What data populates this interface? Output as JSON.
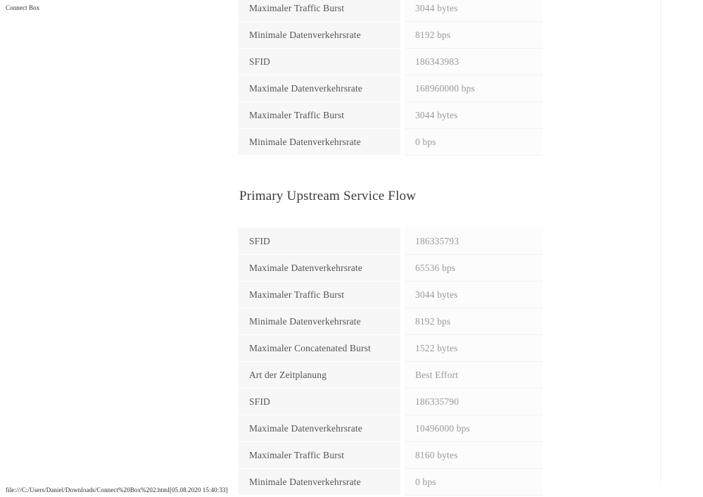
{
  "print": {
    "header_title": "Connect Box",
    "footer_text": "file:///C:/Users/Daniel/Downloads/Connect%20Box%202.html[05.08.2020 15:40:33]"
  },
  "colors": {
    "label_cell_bg": "#f7f7f7",
    "value_cell_bg": "#fcfcfc",
    "label_text": "#555555",
    "value_text": "#999999",
    "heading_text": "#3b3b3b",
    "row_divider": "#f2f2f2"
  },
  "sections": [
    {
      "id": "downstream-service-flow-continued",
      "heading": "",
      "rows": [
        {
          "label": "Maximaler Traffic Burst",
          "value": "3044 bytes"
        },
        {
          "label": "Minimale Datenverkehrsrate",
          "value": "8192 bps"
        },
        {
          "label": "SFID",
          "value": "186343983"
        },
        {
          "label": "Maximale Datenverkehrsrate",
          "value": "168960000 bps"
        },
        {
          "label": "Maximaler Traffic Burst",
          "value": "3044 bytes"
        },
        {
          "label": "Minimale Datenverkehrsrate",
          "value": "0 bps"
        }
      ]
    },
    {
      "id": "primary-upstream-service-flow",
      "heading": "Primary Upstream Service Flow",
      "rows": [
        {
          "label": "SFID",
          "value": "186335793"
        },
        {
          "label": "Maximale Datenverkehrsrate",
          "value": "65536 bps"
        },
        {
          "label": "Maximaler Traffic Burst",
          "value": "3044 bytes"
        },
        {
          "label": "Minimale Datenverkehrsrate",
          "value": "8192 bps"
        },
        {
          "label": "Maximaler Concatenated Burst",
          "value": "1522 bytes"
        },
        {
          "label": "Art der Zeitplanung",
          "value": "Best Effort"
        },
        {
          "label": "SFID",
          "value": "186335790"
        },
        {
          "label": "Maximale Datenverkehrsrate",
          "value": "10496000 bps"
        },
        {
          "label": "Maximaler Traffic Burst",
          "value": "8160 bytes"
        },
        {
          "label": "Minimale Datenverkehrsrate",
          "value": "0 bps"
        }
      ]
    }
  ]
}
